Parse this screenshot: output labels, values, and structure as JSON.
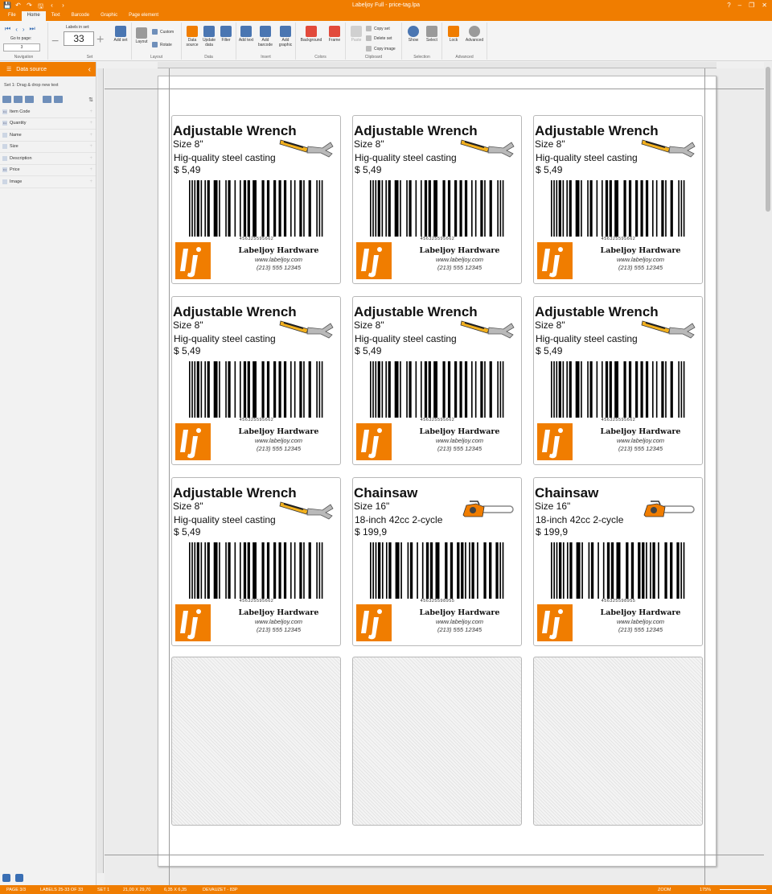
{
  "window": {
    "title": "Labeljoy Full - price-tag.lpa"
  },
  "quick_access": [
    "💾",
    "↶",
    "↷",
    "🖫",
    "‹",
    "›"
  ],
  "tabs": [
    "File",
    "Home",
    "Text",
    "Barcode",
    "Graphic",
    "Page element"
  ],
  "ribbon": {
    "navigation": {
      "goto_label": "Go to page:",
      "page_value": "3",
      "group": "Navigation"
    },
    "set": {
      "labels_in_set_label": "Labels in set:",
      "labels_in_set_value": "33",
      "add_set": "Add set",
      "group": "Set"
    },
    "layout": {
      "layout": "Layout",
      "custom": "Custom",
      "rotate": "Rotate",
      "group": "Layout"
    },
    "data": {
      "data_source": "Data source",
      "update_data": "Update data",
      "filter": "Filter",
      "group": "Data"
    },
    "insert": {
      "add_text": "Add text",
      "add_barcode": "Add barcode",
      "add_graphic": "Add graphic",
      "group": "Insert"
    },
    "colors": {
      "background": "Background",
      "frame": "Frame",
      "group": "Colors"
    },
    "clipboard": {
      "paste": "Paste",
      "copy_set": "Copy set",
      "delete_set": "Delete set",
      "copy_image": "Copy image",
      "group": "Clipboard"
    },
    "selection": {
      "show": "Show",
      "select": "Select",
      "group": "Selection"
    },
    "advanced": {
      "lock": "Lock",
      "advanced": "Advanced",
      "group": "Advanced"
    }
  },
  "sidebar": {
    "title": "Data source",
    "subtitle": "Set 1: Drag & drop new text",
    "fields": [
      {
        "label": "Item Code",
        "type": "0.1"
      },
      {
        "label": "Quantity",
        "type": "0.1"
      },
      {
        "label": "Name",
        "type": ""
      },
      {
        "label": "Size",
        "type": ""
      },
      {
        "label": "Description",
        "type": ""
      },
      {
        "label": "Price",
        "type": "0.1"
      },
      {
        "label": "Image",
        "type": ""
      }
    ]
  },
  "company": {
    "name": "Labeljoy Hardware",
    "web": "www.labeljoy.com",
    "phone": "(213) 555 12345",
    "logo_color": "#f07d00"
  },
  "labels": [
    {
      "name": "Adjustable Wrench",
      "size": "Size 8\"",
      "description": "Hig-quality steel casting",
      "price": "$ 5,49",
      "barcode": "456325595662",
      "image": "wrench-icon"
    },
    {
      "name": "Adjustable Wrench",
      "size": "Size 8\"",
      "description": "Hig-quality steel casting",
      "price": "$ 5,49",
      "barcode": "456325595662",
      "image": "wrench-icon"
    },
    {
      "name": "Adjustable Wrench",
      "size": "Size 8\"",
      "description": "Hig-quality steel casting",
      "price": "$ 5,49",
      "barcode": "456325595662",
      "image": "wrench-icon"
    },
    {
      "name": "Adjustable Wrench",
      "size": "Size 8\"",
      "description": "Hig-quality steel casting",
      "price": "$ 5,49",
      "barcode": "456325595662",
      "image": "wrench-icon"
    },
    {
      "name": "Adjustable Wrench",
      "size": "Size 8\"",
      "description": "Hig-quality steel casting",
      "price": "$ 5,49",
      "barcode": "456325595662",
      "image": "wrench-icon"
    },
    {
      "name": "Adjustable Wrench",
      "size": "Size 8\"",
      "description": "Hig-quality steel casting",
      "price": "$ 5,49",
      "barcode": "456325595662",
      "image": "wrench-icon"
    },
    {
      "name": "Adjustable Wrench",
      "size": "Size 8\"",
      "description": "Hig-quality steel casting",
      "price": "$ 5,49",
      "barcode": "456325595662",
      "image": "wrench-icon"
    },
    {
      "name": "Chainsaw",
      "size": "Size 16\"",
      "description": "18-inch 42cc 2-cycle",
      "price": "$ 199,9",
      "barcode": "456325598955",
      "image": "chainsaw-icon"
    },
    {
      "name": "Chainsaw",
      "size": "Size 16\"",
      "description": "18-inch 42cc 2-cycle",
      "price": "$ 199,9",
      "barcode": "456325598955",
      "image": "chainsaw-icon"
    }
  ],
  "empty_labels": 3,
  "status": {
    "page": "PAGE 3/3",
    "labels": "LABELS 25-33 OF 33",
    "set": "SET 1",
    "size": "21,00 X 29,70",
    "label_size": "6,35 X 6,35",
    "template": "DEVAUZET - 83P",
    "zoom_label": "ZOOM",
    "zoom_value": "175%"
  },
  "colors": {
    "accent": "#f07d00"
  }
}
